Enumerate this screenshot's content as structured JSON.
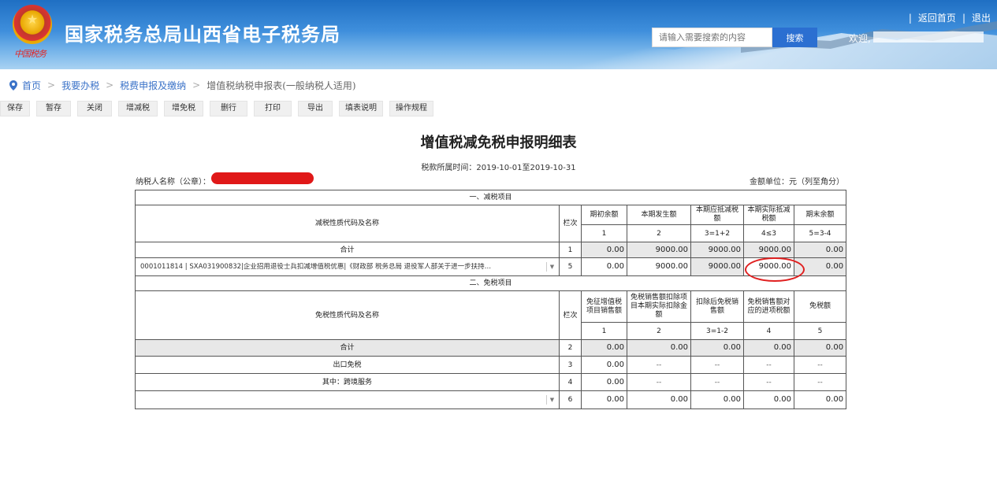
{
  "header": {
    "site_title": "国家税务总局山西省电子税务局",
    "seal_text": "中国税务",
    "search_placeholder": "请输入需要搜索的内容",
    "search_button": "搜索",
    "welcome": "欢迎,",
    "links": {
      "home": "返回首页",
      "logout": "退出",
      "separator": "|"
    }
  },
  "breadcrumb": {
    "items": [
      "首页",
      "我要办税",
      "税费申报及缴纳"
    ],
    "current": "增值税纳税申报表(一般纳税人适用)",
    "separator": ">"
  },
  "toolbar": [
    "保存",
    "暂存",
    "关闭",
    "增减税",
    "增免税",
    "删行",
    "打印",
    "导出",
    "填表说明",
    "操作规程"
  ],
  "doc": {
    "title": "增值税减免税申报明细表",
    "period": "税款所属时间：2019-10-01至2019-10-31",
    "taxpayer_label": "纳税人名称（公章）：",
    "unit": "金额单位：元（列至角分）"
  },
  "reduction": {
    "section_title": "一、减税项目",
    "code_header": "减税性质代码及名称",
    "row_header": "栏次",
    "columns": [
      "期初余额",
      "本期发生额",
      "本期应抵减税额",
      "本期实际抵减税额",
      "期末余额"
    ],
    "formulas": [
      "1",
      "2",
      "3=1+2",
      "4≤3",
      "5=3-4"
    ],
    "total": {
      "label": "合计",
      "row": "1",
      "values": [
        "0.00",
        "9000.00",
        "9000.00",
        "9000.00",
        "0.00"
      ]
    },
    "item": {
      "select_text": "0001011814 | SXA031900832|企业招用退役士兵扣减增值税优惠|《财政部 税务总局 退役军人部关于进一步扶持…",
      "row": "5",
      "values": [
        "0.00",
        "9000.00",
        "9000.00",
        "9000.00",
        "0.00"
      ]
    }
  },
  "exemption": {
    "section_title": "二、免税项目",
    "code_header": "免税性质代码及名称",
    "row_header": "栏次",
    "columns": [
      "免征增值税项目销售额",
      "免税销售额扣除项目本期实际扣除金额",
      "扣除后免税销售额",
      "免税销售额对应的进项税额",
      "免税额"
    ],
    "formulas": [
      "1",
      "2",
      "3=1-2",
      "4",
      "5"
    ],
    "total": {
      "label": "合计",
      "row": "2",
      "values": [
        "0.00",
        "0.00",
        "0.00",
        "0.00",
        "0.00"
      ]
    },
    "export": {
      "label": "出口免税",
      "row": "3",
      "values": [
        "0.00",
        "--",
        "--",
        "--",
        "--"
      ]
    },
    "cross_border": {
      "label": "其中：跨境服务",
      "row": "4",
      "values": [
        "0.00",
        "--",
        "--",
        "--",
        "--"
      ]
    },
    "item": {
      "select_text": "",
      "row": "6",
      "values": [
        "0.00",
        "0.00",
        "0.00",
        "0.00",
        "0.00"
      ]
    }
  }
}
